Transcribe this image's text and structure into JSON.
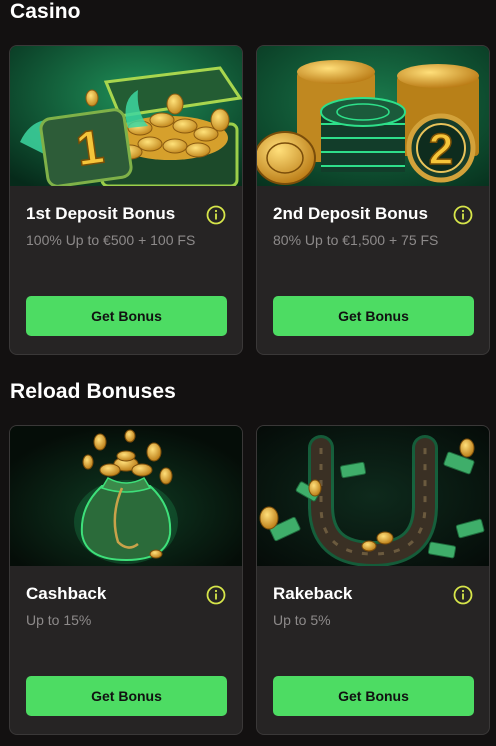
{
  "sections": [
    {
      "title": "Casino",
      "cards": [
        {
          "title": "1st Deposit Bonus",
          "subtitle": "100% Up to €500 + 100 FS",
          "button": "Get Bonus"
        },
        {
          "title": "2nd Deposit Bonus",
          "subtitle": "80% Up to €1,500 + 75 FS",
          "button": "Get Bonus"
        }
      ]
    },
    {
      "title": "Reload Bonuses",
      "cards": [
        {
          "title": "Cashback",
          "subtitle": "Up to 15%",
          "button": "Get Bonus"
        },
        {
          "title": "Rakeback",
          "subtitle": "Up to 5%",
          "button": "Get Bonus"
        }
      ]
    }
  ],
  "colors": {
    "background": "#131111",
    "card": "#262424",
    "accent_button": "#4ddc63",
    "info_icon": "#d6e54a",
    "subtitle": "#8d8a8a"
  },
  "icons": {
    "info": "info-circle-icon"
  },
  "artwork": {
    "card_1": "deposit-1-treasure-chest-image",
    "card_2": "deposit-2-casino-chips-image",
    "card_3": "cashback-money-bag-image",
    "card_4": "rakeback-horseshoe-image"
  }
}
